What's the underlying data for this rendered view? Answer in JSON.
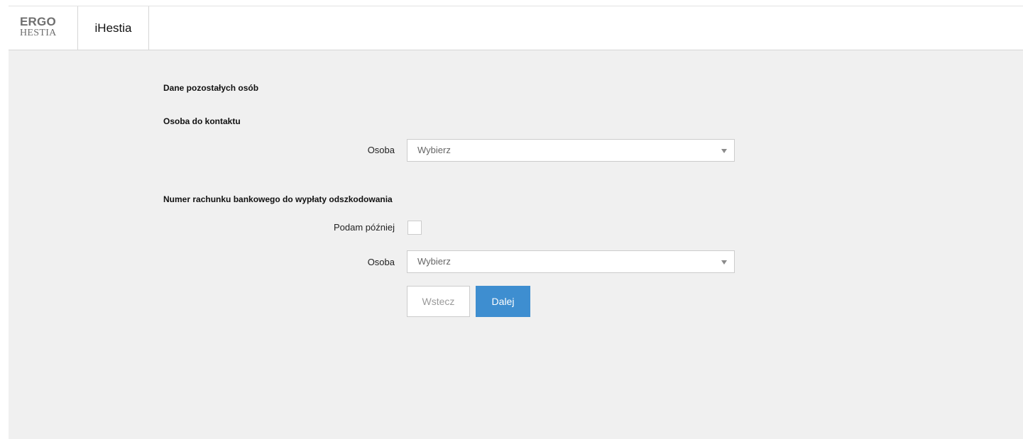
{
  "header": {
    "logo_line1": "ERGO",
    "logo_line2": "HESTIA",
    "app_name": "iHestia"
  },
  "form": {
    "title": "Dane pozostałych osób",
    "contact_section": {
      "heading": "Osoba do kontaktu",
      "person_label": "Osoba",
      "person_value": "Wybierz"
    },
    "bank_section": {
      "heading": "Numer rachunku bankowego do wypłaty odszkodowania",
      "later_label": "Podam później",
      "later_checked": false,
      "person_label": "Osoba",
      "person_value": "Wybierz"
    },
    "buttons": {
      "back_label": "Wstecz",
      "next_label": "Dalej"
    }
  },
  "colors": {
    "accent": "#3e8ed0",
    "page_background": "#f0f0f0",
    "header_background": "#ffffff"
  },
  "icons": {
    "select_arrow": "chevron-down-icon"
  }
}
